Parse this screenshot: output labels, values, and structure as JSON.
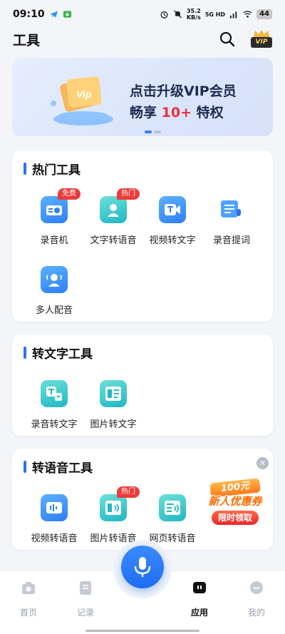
{
  "status_bar": {
    "time": "09:10",
    "net_speed_value": "35.2",
    "net_speed_unit": "KB/s",
    "network": "5G HD",
    "battery": "44"
  },
  "header": {
    "title": "工具",
    "vip_label": "VIP"
  },
  "banner": {
    "line1": "点击升级VIP会员",
    "line2_prefix": "畅享 ",
    "line2_highlight": "10+",
    "line2_suffix": " 特权"
  },
  "sections": {
    "hot": {
      "title": "热门工具",
      "tools": [
        {
          "label": "录音机",
          "tag": "免费"
        },
        {
          "label": "文字转语音",
          "tag": "热门"
        },
        {
          "label": "视频转文字",
          "tag": ""
        },
        {
          "label": "录音提词",
          "tag": ""
        },
        {
          "label": "多人配音",
          "tag": ""
        }
      ]
    },
    "to_text": {
      "title": "转文字工具",
      "tools": [
        {
          "label": "录音转文字",
          "tag": ""
        },
        {
          "label": "图片转文字",
          "tag": ""
        }
      ]
    },
    "to_voice": {
      "title": "转语音工具",
      "tools": [
        {
          "label": "视频转语音",
          "tag": ""
        },
        {
          "label": "图片转语音",
          "tag": "热门"
        },
        {
          "label": "网页转语音",
          "tag": ""
        }
      ]
    }
  },
  "coupon": {
    "amount": "100元",
    "title": "新人优惠券",
    "button": "限时领取"
  },
  "tabbar": {
    "items": [
      {
        "label": "首页"
      },
      {
        "label": "记录"
      },
      {
        "label": "应用"
      },
      {
        "label": "我的"
      }
    ]
  },
  "colors": {
    "accent": "#2f6ff0",
    "tag_red": "#ee3b3b",
    "vip_gold": "#f4cf63"
  }
}
